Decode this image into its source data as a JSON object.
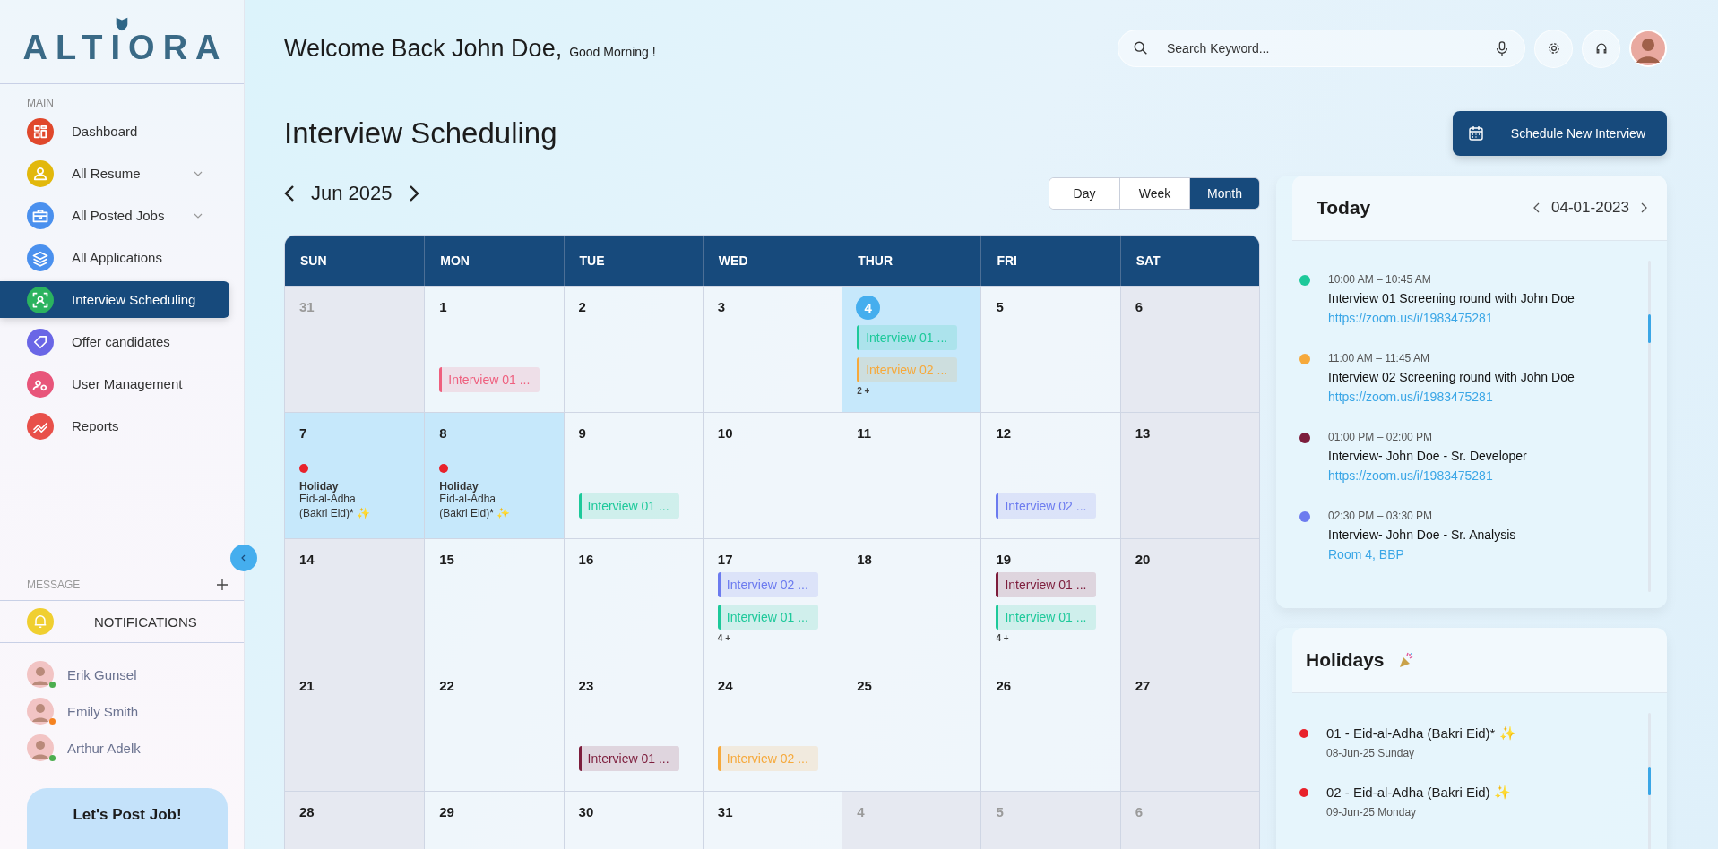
{
  "sidebar": {
    "logo": "ALTIORA",
    "main_label": "MAIN",
    "items": [
      {
        "label": "Dashboard",
        "color": "#e0482c",
        "selected": false,
        "expandable": false
      },
      {
        "label": "All Resume",
        "color": "#e2b80c",
        "selected": false,
        "expandable": true
      },
      {
        "label": "All Posted Jobs",
        "color": "#4a90ee",
        "selected": false,
        "expandable": true
      },
      {
        "label": "All Applications",
        "color": "#4a90ee",
        "selected": false,
        "expandable": false
      },
      {
        "label": "Interview Scheduling",
        "color": "#2bb35f",
        "selected": true,
        "expandable": false
      },
      {
        "label": "Offer candidates",
        "color": "#6a66e6",
        "selected": false,
        "expandable": false
      },
      {
        "label": "User Management",
        "color": "#e8557a",
        "selected": false,
        "expandable": false
      },
      {
        "label": "Reports",
        "color": "#e8504a",
        "selected": false,
        "expandable": false
      }
    ],
    "message_label": "MESSAGE",
    "notifications": "NOTIFICATIONS",
    "contacts": [
      {
        "name": "Erik Gunsel",
        "color": "#4cae4f"
      },
      {
        "name": "Emily Smith",
        "color": "#f58220"
      },
      {
        "name": "Arthur Adelk",
        "color": "#4cae4f"
      }
    ],
    "post_job": "Let's Post Job!"
  },
  "header": {
    "welcome": "Welcome Back John Doe,",
    "greeting": "Good Morning !",
    "search": {
      "placeholder": "Search Keyword..."
    }
  },
  "page_title": "Interview Scheduling",
  "schedule_button": "Schedule New Interview",
  "calendar": {
    "month": "Jun 2025",
    "views": [
      {
        "label": "Day",
        "selected": false
      },
      {
        "label": "Week",
        "selected": false
      },
      {
        "label": "Month",
        "selected": true
      }
    ],
    "weekdays": [
      "SUN",
      "MON",
      "TUE",
      "WED",
      "THUR",
      "FRI",
      "SAT"
    ],
    "days": [
      {
        "day": "31",
        "kind": "other"
      },
      {
        "day": "1",
        "kind": "normal",
        "events": [
          {
            "label": "Interview 01 ...",
            "color": "#ef5f7e"
          }
        ]
      },
      {
        "day": "2",
        "kind": "normal"
      },
      {
        "day": "3",
        "kind": "normal"
      },
      {
        "day": "4",
        "kind": "today",
        "events": [
          {
            "label": "Interview 01 ...",
            "color": "#1dc99a"
          },
          {
            "label": "Interview 02 ...",
            "color": "#f6a93b"
          }
        ],
        "more": "2 +"
      },
      {
        "day": "5",
        "kind": "normal"
      },
      {
        "day": "6",
        "kind": "weekend"
      },
      {
        "day": "7",
        "kind": "holiday",
        "holiday": {
          "title": "Holiday",
          "name": "Eid-al-Adha (Bakri Eid)* ✨"
        }
      },
      {
        "day": "8",
        "kind": "holiday",
        "holiday": {
          "title": "Holiday",
          "name": "Eid-al-Adha (Bakri Eid)* ✨"
        }
      },
      {
        "day": "9",
        "kind": "normal",
        "events": [
          {
            "label": "Interview 01 ...",
            "color": "#1dc99a"
          }
        ]
      },
      {
        "day": "10",
        "kind": "normal"
      },
      {
        "day": "11",
        "kind": "normal"
      },
      {
        "day": "12",
        "kind": "normal",
        "events": [
          {
            "label": "Interview 02 ...",
            "color": "#6c7bef"
          }
        ]
      },
      {
        "day": "13",
        "kind": "weekend"
      },
      {
        "day": "14",
        "kind": "weekend"
      },
      {
        "day": "15",
        "kind": "normal"
      },
      {
        "day": "16",
        "kind": "normal"
      },
      {
        "day": "17",
        "kind": "normal",
        "events": [
          {
            "label": "Interview 02 ...",
            "color": "#6c7bef"
          },
          {
            "label": "Interview 01 ...",
            "color": "#1dc99a"
          }
        ],
        "more": "4 +"
      },
      {
        "day": "18",
        "kind": "normal"
      },
      {
        "day": "19",
        "kind": "normal",
        "events": [
          {
            "label": "Interview 01 ...",
            "color": "#7d1d3c"
          },
          {
            "label": "Interview 01 ...",
            "color": "#1dc99a"
          }
        ],
        "more": "4 +"
      },
      {
        "day": "20",
        "kind": "weekend"
      },
      {
        "day": "21",
        "kind": "weekend"
      },
      {
        "day": "22",
        "kind": "normal"
      },
      {
        "day": "23",
        "kind": "normal",
        "events": [
          {
            "label": "Interview 01 ...",
            "color": "#7d1d3c"
          }
        ]
      },
      {
        "day": "24",
        "kind": "normal",
        "events": [
          {
            "label": "Interview 02 ...",
            "color": "#f6a93b"
          }
        ]
      },
      {
        "day": "25",
        "kind": "normal"
      },
      {
        "day": "26",
        "kind": "normal"
      },
      {
        "day": "27",
        "kind": "weekend"
      },
      {
        "day": "28",
        "kind": "weekend"
      },
      {
        "day": "29",
        "kind": "normal"
      },
      {
        "day": "30",
        "kind": "normal"
      },
      {
        "day": "31",
        "kind": "normal"
      },
      {
        "day": "4",
        "kind": "other"
      },
      {
        "day": "5",
        "kind": "other"
      },
      {
        "day": "6",
        "kind": "other"
      }
    ]
  },
  "today": {
    "title": "Today",
    "date": "04-01-2023",
    "items": [
      {
        "time": "10:00 AM – 10:45 AM",
        "title": "Interview 01 Screening round with John Doe",
        "location": "https://zoom.us/i/1983475281",
        "color": "#1dc99a"
      },
      {
        "time": "11:00 AM – 11:45 AM",
        "title": "Interview 02 Screening round with John Doe",
        "location": "https://zoom.us/i/1983475281",
        "color": "#f6a93b"
      },
      {
        "time": "01:00 PM – 02:00 PM",
        "title": "Interview- John Doe - Sr. Developer",
        "location": "https://zoom.us/i/1983475281",
        "color": "#7d1d3c"
      },
      {
        "time": "02:30 PM – 03:30 PM",
        "title": "Interview- John Doe - Sr. Analysis",
        "location": "Room 4, BBP",
        "color": "#6c7bef"
      }
    ]
  },
  "holidays": {
    "title": "Holidays",
    "items": [
      {
        "name": "01 - Eid-al-Adha (Bakri Eid)* ✨",
        "date": "08-Jun-25 Sunday",
        "color": "#e8222b"
      },
      {
        "name": "02 - Eid-al-Adha (Bakri Eid) ✨",
        "date": "09-Jun-25 Monday",
        "color": "#e8222b"
      }
    ]
  }
}
